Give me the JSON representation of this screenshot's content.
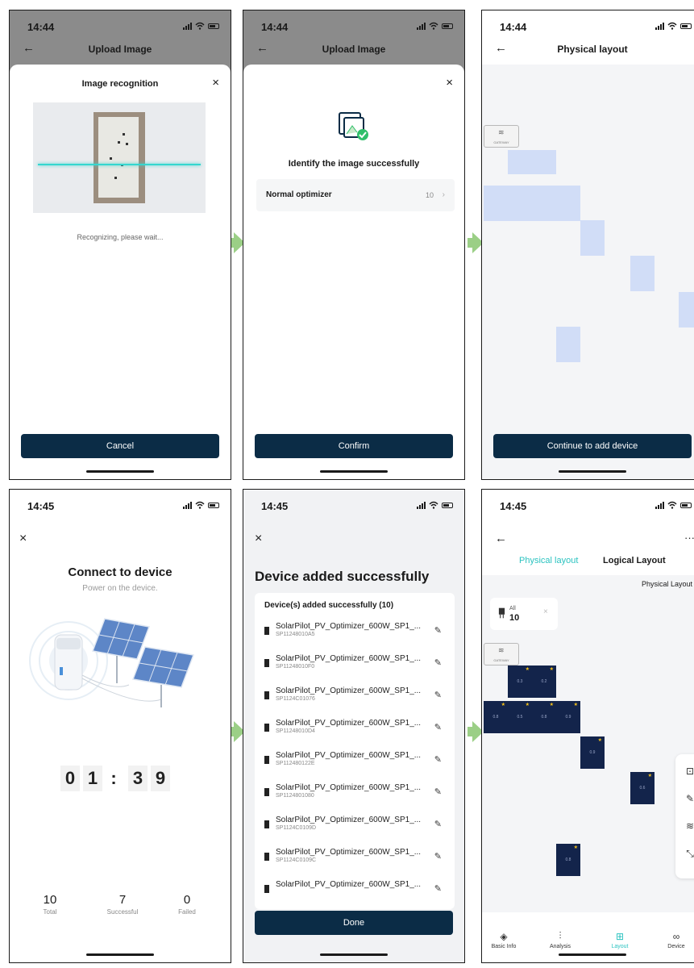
{
  "screens": {
    "s1": {
      "time": "14:44",
      "nav_title": "Upload Image",
      "modal_title": "Image recognition",
      "status": "Recognizing, please wait...",
      "button": "Cancel"
    },
    "s2": {
      "time": "14:44",
      "nav_title": "Upload Image",
      "success_title": "Identify the image successfully",
      "row_label": "Normal optimizer",
      "row_count": "10",
      "button": "Confirm"
    },
    "s3": {
      "time": "14:44",
      "nav_title": "Physical layout",
      "button": "Continue to add device"
    },
    "s4": {
      "time": "14:45",
      "title": "Connect to device",
      "subtitle": "Power on the device.",
      "countdown": [
        "0",
        "1",
        ":",
        "3",
        "9"
      ],
      "stats": [
        {
          "value": "10",
          "label": "Total"
        },
        {
          "value": "7",
          "label": "Successful"
        },
        {
          "value": "0",
          "label": "Failed"
        }
      ]
    },
    "s5": {
      "time": "14:45",
      "title": "Device added successfully",
      "list_header": "Device(s) added successfully (10)",
      "devices": [
        {
          "name": "SolarPilot_PV_Optimizer_600W_SP1_...",
          "sn": "SP11248010A5"
        },
        {
          "name": "SolarPilot_PV_Optimizer_600W_SP1_...",
          "sn": "SP11248010F0"
        },
        {
          "name": "SolarPilot_PV_Optimizer_600W_SP1_...",
          "sn": "SP1124C01076"
        },
        {
          "name": "SolarPilot_PV_Optimizer_600W_SP1_...",
          "sn": "SP11248010D4"
        },
        {
          "name": "SolarPilot_PV_Optimizer_600W_SP1_...",
          "sn": "SP112480122E"
        },
        {
          "name": "SolarPilot_PV_Optimizer_600W_SP1_...",
          "sn": "SP1124801080"
        },
        {
          "name": "SolarPilot_PV_Optimizer_600W_SP1_...",
          "sn": "SP1124C0109D"
        },
        {
          "name": "SolarPilot_PV_Optimizer_600W_SP1_...",
          "sn": "SP1124C0109C"
        },
        {
          "name": "SolarPilot_PV_Optimizer_600W_SP1_...",
          "sn": ""
        }
      ],
      "button": "Done"
    },
    "s6": {
      "time": "14:45",
      "tabs": [
        "Physical layout",
        "Logical Layout"
      ],
      "dropdown": "Physical Layout ▾",
      "all_label": "All",
      "all_count": "10",
      "bottom_tabs": [
        "Basic Info",
        "Analysis",
        "Layout",
        "Device"
      ],
      "panel_values": [
        "0.3",
        "0.2",
        "0.8",
        "0.5",
        "0.8",
        "0.9",
        "0.9",
        "0.6",
        "0.8"
      ]
    }
  },
  "colors": {
    "accent": "#2bc3c0",
    "dark_button": "#0b2c46",
    "panel": "#13244b",
    "blue_tile": "#d1ddf7",
    "arrow": "#9bcf86"
  }
}
